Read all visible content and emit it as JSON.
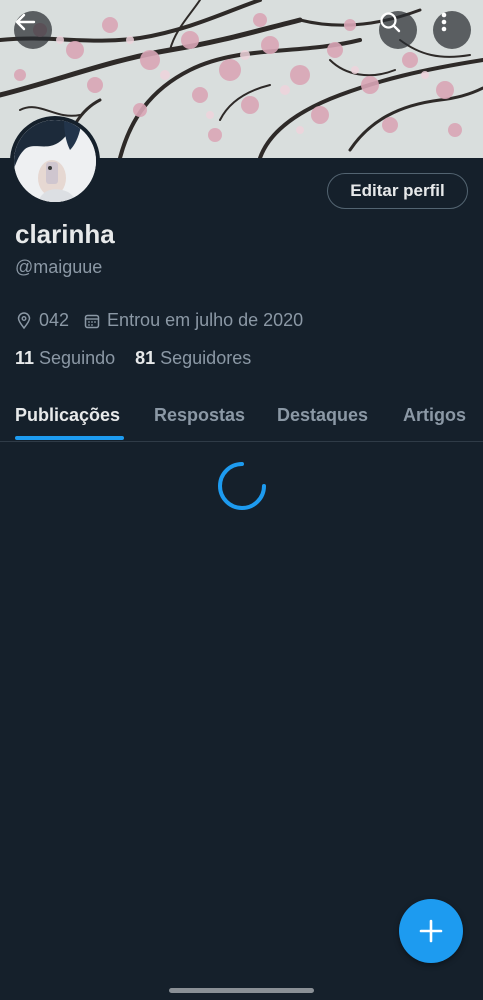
{
  "header": {
    "back_icon": "arrow-left-icon",
    "search_icon": "search-icon",
    "more_icon": "more-vertical-icon"
  },
  "profile": {
    "display_name": "clarinha",
    "handle": "@maiguue",
    "edit_button_label": "Editar perfil",
    "location": "042",
    "joined": "Entrou em julho de 2020",
    "following_count": "11",
    "following_label": "Seguindo",
    "followers_count": "81",
    "followers_label": "Seguidores"
  },
  "tabs": [
    {
      "label": "Publicações",
      "active": true
    },
    {
      "label": "Respostas",
      "active": false
    },
    {
      "label": "Destaques",
      "active": false
    },
    {
      "label": "Artigos",
      "active": false
    }
  ],
  "colors": {
    "background": "#15202b",
    "accent": "#1d9bf0",
    "secondary_text": "#8b98a5",
    "primary_text": "#e7e9ea"
  },
  "fab": {
    "icon": "plus-icon"
  }
}
